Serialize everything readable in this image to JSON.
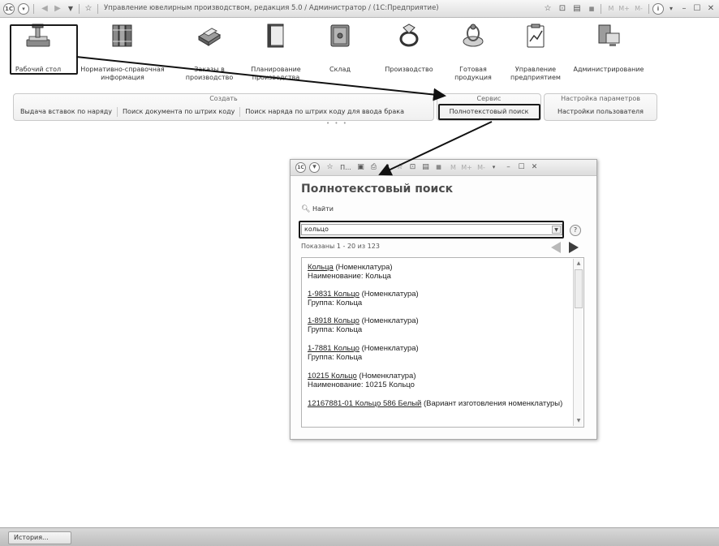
{
  "window": {
    "title": "Управление ювелирным производством, редакция 5.0 / Администратор / (1С:Предприятие)",
    "logo": "1С",
    "memory_buttons": [
      "M",
      "M+",
      "M-"
    ],
    "icons": [
      "1c-logo-icon",
      "menu-icon",
      "back-icon",
      "forward-icon",
      "dropdown-icon",
      "favorites-icon",
      "star-icon",
      "history-icon",
      "calculator-icon",
      "calendar-icon",
      "info-icon",
      "minimize-icon",
      "maximize-icon",
      "close-icon"
    ]
  },
  "sections": [
    {
      "label": "Рабочий стол",
      "icon": "desktop-icon"
    },
    {
      "label": "Нормативно-справочная информация",
      "icon": "reference-books-icon"
    },
    {
      "label": "Заказы в производство",
      "icon": "printer-icon"
    },
    {
      "label": "Планирование производства",
      "icon": "book-icon"
    },
    {
      "label": "Склад",
      "icon": "safe-icon"
    },
    {
      "label": "Производство",
      "icon": "ring-icon"
    },
    {
      "label": "Готовая продукция",
      "icon": "jewelry-icon"
    },
    {
      "label": "Управление предприятием",
      "icon": "clipboard-chart-icon"
    },
    {
      "label": "Администрирование",
      "icon": "server-icon"
    }
  ],
  "command_groups": [
    {
      "title": "Создать",
      "items": [
        "Выдача вставок по наряду",
        "Поиск документа по штрих коду",
        "Поиск наряда по штрих коду для ввода брака"
      ]
    },
    {
      "title": "Сервис",
      "items": [
        "Полнотекстовый поиск"
      ]
    },
    {
      "title": "Настройка параметров",
      "items": [
        "Настройки пользователя"
      ]
    }
  ],
  "dialog": {
    "title": "Полнотекстовый поиск",
    "toolbar_label": "П...",
    "memory_buttons": [
      "M",
      "M+",
      "M-"
    ],
    "find_label": "Найти",
    "search_value": "кольцо",
    "help_label": "?",
    "shown_text": "Показаны 1 - 20 из 123",
    "results": [
      {
        "link": "Кольца",
        "type": " (Номенклатура)",
        "sub": "Наименование: Кольца"
      },
      {
        "link": "1-9831 Кольцо",
        "type": " (Номенклатура)",
        "sub": "Группа: Кольца"
      },
      {
        "link": "1-8918 Кольцо",
        "type": " (Номенклатура)",
        "sub": "Группа: Кольца"
      },
      {
        "link": "1-7881 Кольцо",
        "type": " (Номенклатура)",
        "sub": "Группа: Кольца"
      },
      {
        "link": "10215 Кольцо",
        "type": " (Номенклатура)",
        "sub": "Наименование: 10215 Кольцо"
      },
      {
        "link": "12167881-01 Кольцо 586 Белый",
        "type": " (Вариант изготовления номенклатуры)",
        "sub": ""
      }
    ]
  },
  "bottom": {
    "history_label": "История..."
  }
}
